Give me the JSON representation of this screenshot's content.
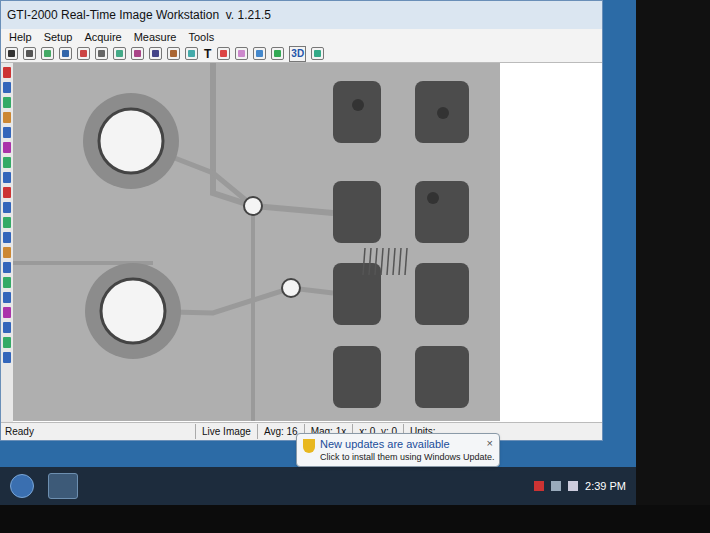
{
  "window": {
    "title": "GTI-2000 Real-Time Image Workstation  v. 1.21.5"
  },
  "menu": [
    "Help",
    "Setup",
    "Acquire",
    "Measure",
    "Tools"
  ],
  "toolbar_labels": [
    "T",
    "3D"
  ],
  "status_bar": {
    "message": "Ready",
    "fields": [
      "Live Image",
      "Avg: 16",
      "Mag: 1x",
      "x: 0  y: 0",
      "Units:"
    ]
  },
  "notification": {
    "title": "New updates are available",
    "text": "Click to install them using Windows Update.",
    "close": "×"
  },
  "taskbar": {
    "time": "2:39 PM"
  }
}
